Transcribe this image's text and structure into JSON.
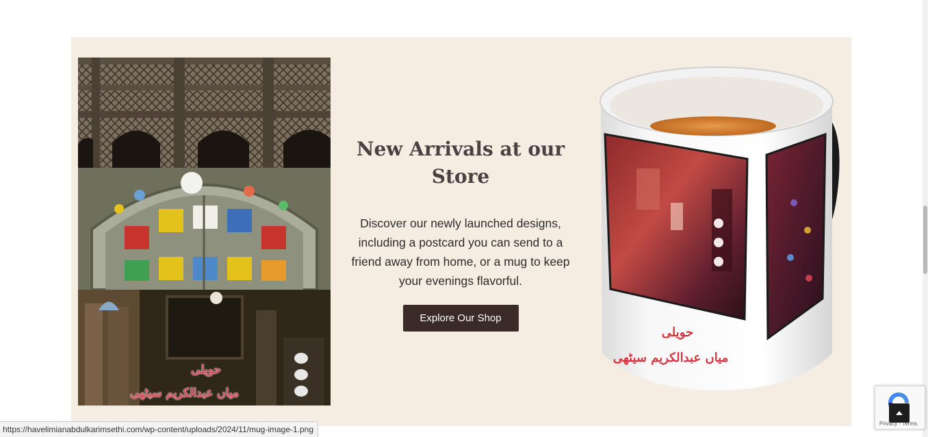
{
  "promo": {
    "heading": "New Arrivals at our Store",
    "description": "Discover our newly launched designs, including a postcard you can send to a friend away from home, or a mug to keep your evenings flavorful.",
    "button_label": "Explore Our Shop",
    "background_color": "#f5ede2",
    "button_color": "#3b2b28"
  },
  "collage": {
    "caption_line1": "حویلی",
    "caption_line2": "میاں عبدالکریم سیٹھی"
  },
  "mug": {
    "caption_line1": "حویلی",
    "caption_line2": "میاں عبدالکریم سیٹھی"
  },
  "status_bar": {
    "url": "https://havelimianabdulkarimsethi.com/wp-content/uploads/2024/11/mug-image-1.png"
  },
  "recaptcha": {
    "privacy_label": "Privacy",
    "terms_label": "Terms",
    "separator": " - "
  },
  "icons": {
    "back_to_top": "chevron-up-icon",
    "recaptcha": "recaptcha-icon"
  }
}
